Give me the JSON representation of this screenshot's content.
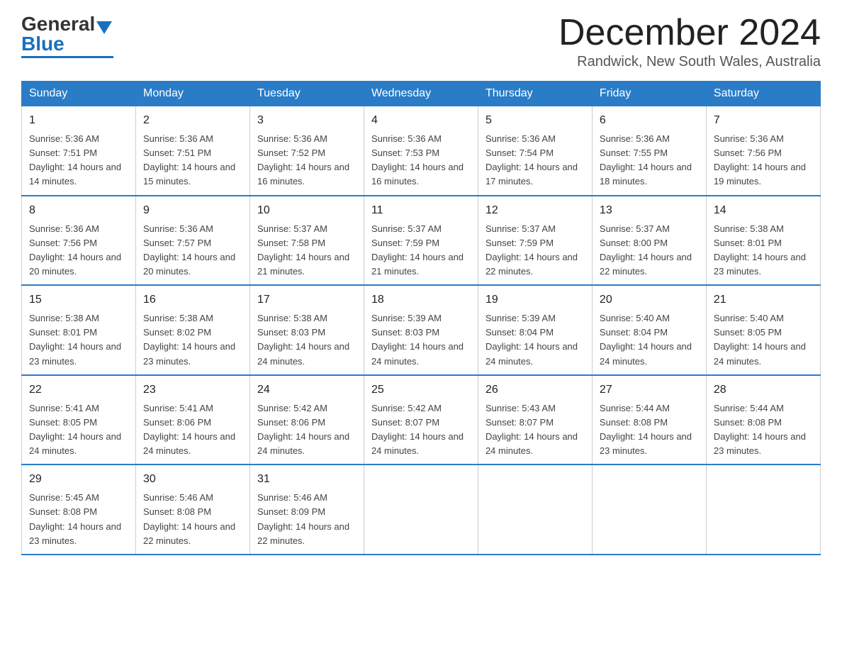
{
  "header": {
    "logo_general": "General",
    "logo_blue": "Blue",
    "title": "December 2024",
    "location": "Randwick, New South Wales, Australia"
  },
  "weekdays": [
    "Sunday",
    "Monday",
    "Tuesday",
    "Wednesday",
    "Thursday",
    "Friday",
    "Saturday"
  ],
  "weeks": [
    [
      {
        "day": "1",
        "sunrise": "5:36 AM",
        "sunset": "7:51 PM",
        "daylight": "14 hours and 14 minutes."
      },
      {
        "day": "2",
        "sunrise": "5:36 AM",
        "sunset": "7:51 PM",
        "daylight": "14 hours and 15 minutes."
      },
      {
        "day": "3",
        "sunrise": "5:36 AM",
        "sunset": "7:52 PM",
        "daylight": "14 hours and 16 minutes."
      },
      {
        "day": "4",
        "sunrise": "5:36 AM",
        "sunset": "7:53 PM",
        "daylight": "14 hours and 16 minutes."
      },
      {
        "day": "5",
        "sunrise": "5:36 AM",
        "sunset": "7:54 PM",
        "daylight": "14 hours and 17 minutes."
      },
      {
        "day": "6",
        "sunrise": "5:36 AM",
        "sunset": "7:55 PM",
        "daylight": "14 hours and 18 minutes."
      },
      {
        "day": "7",
        "sunrise": "5:36 AM",
        "sunset": "7:56 PM",
        "daylight": "14 hours and 19 minutes."
      }
    ],
    [
      {
        "day": "8",
        "sunrise": "5:36 AM",
        "sunset": "7:56 PM",
        "daylight": "14 hours and 20 minutes."
      },
      {
        "day": "9",
        "sunrise": "5:36 AM",
        "sunset": "7:57 PM",
        "daylight": "14 hours and 20 minutes."
      },
      {
        "day": "10",
        "sunrise": "5:37 AM",
        "sunset": "7:58 PM",
        "daylight": "14 hours and 21 minutes."
      },
      {
        "day": "11",
        "sunrise": "5:37 AM",
        "sunset": "7:59 PM",
        "daylight": "14 hours and 21 minutes."
      },
      {
        "day": "12",
        "sunrise": "5:37 AM",
        "sunset": "7:59 PM",
        "daylight": "14 hours and 22 minutes."
      },
      {
        "day": "13",
        "sunrise": "5:37 AM",
        "sunset": "8:00 PM",
        "daylight": "14 hours and 22 minutes."
      },
      {
        "day": "14",
        "sunrise": "5:38 AM",
        "sunset": "8:01 PM",
        "daylight": "14 hours and 23 minutes."
      }
    ],
    [
      {
        "day": "15",
        "sunrise": "5:38 AM",
        "sunset": "8:01 PM",
        "daylight": "14 hours and 23 minutes."
      },
      {
        "day": "16",
        "sunrise": "5:38 AM",
        "sunset": "8:02 PM",
        "daylight": "14 hours and 23 minutes."
      },
      {
        "day": "17",
        "sunrise": "5:38 AM",
        "sunset": "8:03 PM",
        "daylight": "14 hours and 24 minutes."
      },
      {
        "day": "18",
        "sunrise": "5:39 AM",
        "sunset": "8:03 PM",
        "daylight": "14 hours and 24 minutes."
      },
      {
        "day": "19",
        "sunrise": "5:39 AM",
        "sunset": "8:04 PM",
        "daylight": "14 hours and 24 minutes."
      },
      {
        "day": "20",
        "sunrise": "5:40 AM",
        "sunset": "8:04 PM",
        "daylight": "14 hours and 24 minutes."
      },
      {
        "day": "21",
        "sunrise": "5:40 AM",
        "sunset": "8:05 PM",
        "daylight": "14 hours and 24 minutes."
      }
    ],
    [
      {
        "day": "22",
        "sunrise": "5:41 AM",
        "sunset": "8:05 PM",
        "daylight": "14 hours and 24 minutes."
      },
      {
        "day": "23",
        "sunrise": "5:41 AM",
        "sunset": "8:06 PM",
        "daylight": "14 hours and 24 minutes."
      },
      {
        "day": "24",
        "sunrise": "5:42 AM",
        "sunset": "8:06 PM",
        "daylight": "14 hours and 24 minutes."
      },
      {
        "day": "25",
        "sunrise": "5:42 AM",
        "sunset": "8:07 PM",
        "daylight": "14 hours and 24 minutes."
      },
      {
        "day": "26",
        "sunrise": "5:43 AM",
        "sunset": "8:07 PM",
        "daylight": "14 hours and 24 minutes."
      },
      {
        "day": "27",
        "sunrise": "5:44 AM",
        "sunset": "8:08 PM",
        "daylight": "14 hours and 23 minutes."
      },
      {
        "day": "28",
        "sunrise": "5:44 AM",
        "sunset": "8:08 PM",
        "daylight": "14 hours and 23 minutes."
      }
    ],
    [
      {
        "day": "29",
        "sunrise": "5:45 AM",
        "sunset": "8:08 PM",
        "daylight": "14 hours and 23 minutes."
      },
      {
        "day": "30",
        "sunrise": "5:46 AM",
        "sunset": "8:08 PM",
        "daylight": "14 hours and 22 minutes."
      },
      {
        "day": "31",
        "sunrise": "5:46 AM",
        "sunset": "8:09 PM",
        "daylight": "14 hours and 22 minutes."
      },
      null,
      null,
      null,
      null
    ]
  ]
}
